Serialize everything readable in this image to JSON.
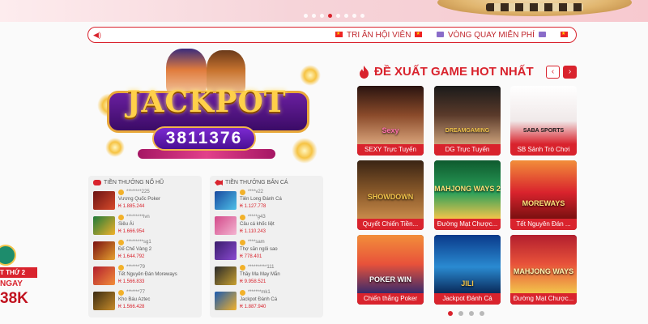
{
  "colors": {
    "accent": "#d9232d",
    "gold": "#f2b12a",
    "panel": "#f0f0f0"
  },
  "banner": {
    "slide_count": 8,
    "active_slide": 4
  },
  "marquee": {
    "speaker_icon": "speaker-icon",
    "item1": "TRI ÂN HỘI VIÊN",
    "item2": "VÒNG QUAY MIỄN PHÍ"
  },
  "jackpot": {
    "word": "JACKPOT",
    "amount": "3811376"
  },
  "slots_panel": {
    "title": "TIỀN THƯỞNG NỔ HŨ",
    "rows": [
      {
        "user": "********225",
        "game": "Vương Quốc Poker",
        "amount": "₭ 1.885.244"
      },
      {
        "user": "*********lvn",
        "game": "Siêu Ái",
        "amount": "₭ 1.666.954"
      },
      {
        "user": "*********sg1",
        "game": "Đế Chế Vàng 2",
        "amount": "₭ 1.644.792"
      },
      {
        "user": "*******79",
        "game": "Tết Nguyên Đán Moreways",
        "amount": "₭ 1.566.833"
      },
      {
        "user": "*******77",
        "game": "Kho Báu Aztec",
        "amount": "₭ 1.566.428"
      }
    ]
  },
  "fishing_panel": {
    "title": "TIỀN THƯỞNG BẮN CÁ",
    "rows": [
      {
        "user": "****v22",
        "game": "Tiên Long Đánh Cá",
        "amount": "₭ 1.127.778"
      },
      {
        "user": "*****g43",
        "game": "Câu cá khốc liệt",
        "amount": "₭ 1.110.243"
      },
      {
        "user": "****sam",
        "game": "Thợ săn ngôi sao",
        "amount": "₭ 778.401"
      },
      {
        "user": "**********111",
        "game": "Thầy Ma May Mắn",
        "amount": "₭ 9.958.521"
      },
      {
        "user": "*******mk1",
        "game": "Jackpot Đánh Cá",
        "amount": "₭ 1.887.940"
      }
    ]
  },
  "hot_games": {
    "title": "ĐỀ XUẤT GAME HOT NHẤT",
    "prev": "‹",
    "next": "›",
    "cards": [
      {
        "label": "SEXY Trực Tuyến",
        "logo": "Sexy"
      },
      {
        "label": "DG Trực Tuyến",
        "logo": "DREAMGAMING"
      },
      {
        "label": "SB Sảnh Trò Chơi",
        "logo": "SABA SPORTS"
      },
      {
        "label": "Quyết Chiến Tiền...",
        "logo": "SHOWDOWN"
      },
      {
        "label": "Đường Mạt Chược...",
        "logo": "MAHJONG WAYS 2"
      },
      {
        "label": "Tết Nguyên Đán ...",
        "logo": "MOREWAYS"
      },
      {
        "label": "Chiến thắng Poker",
        "logo": "POKER WIN"
      },
      {
        "label": "Jackpot Đánh Cá",
        "logo": "JILI"
      },
      {
        "label": "Đường Mạt Chược...",
        "logo": "MAHJONG WAYS"
      }
    ],
    "pages": 4,
    "active_page": 1
  },
  "float_promo": {
    "strip": "T THỨ 2",
    "line1": "NGAY",
    "line2": "38K"
  }
}
